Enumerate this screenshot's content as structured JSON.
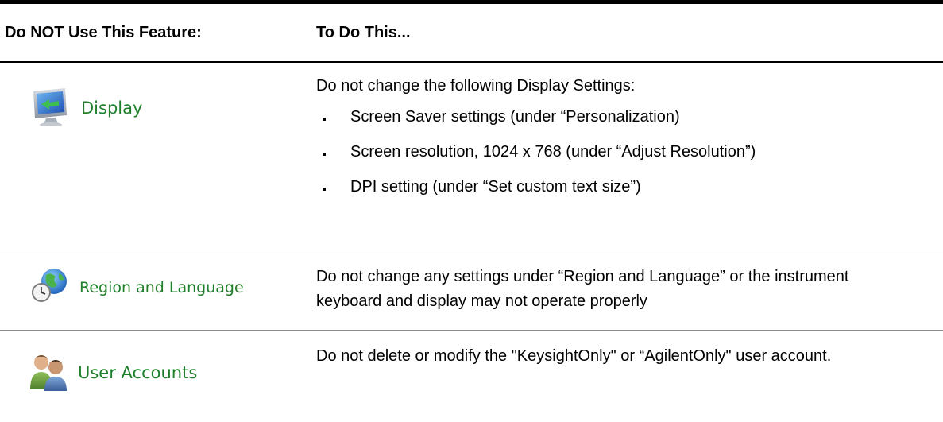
{
  "table": {
    "header": {
      "col1": "Do NOT Use This Feature:",
      "col2": "To Do This..."
    },
    "rows": [
      {
        "feature": "Display",
        "icon": "display-monitor-icon",
        "text": "Do not change the following Display Settings:",
        "bullets": [
          "Screen Saver settings (under “Personalization)",
          "Screen resolution, 1024 x 768 (under “Adjust Resolution”)",
          "DPI setting (under “Set custom text size”)"
        ]
      },
      {
        "feature": "Region and Language",
        "icon": "globe-clock-icon",
        "text": "Do not change any settings under “Region and Language” or the instrument keyboard and display may not operate properly"
      },
      {
        "feature": "User Accounts",
        "icon": "user-accounts-icon",
        "text": "Do not delete or modify the \"KeysightOnly\" or “AgilentOnly\" user account."
      }
    ]
  },
  "colors": {
    "label_green": "#1e7f2a",
    "rule": "#8c8c8c"
  }
}
